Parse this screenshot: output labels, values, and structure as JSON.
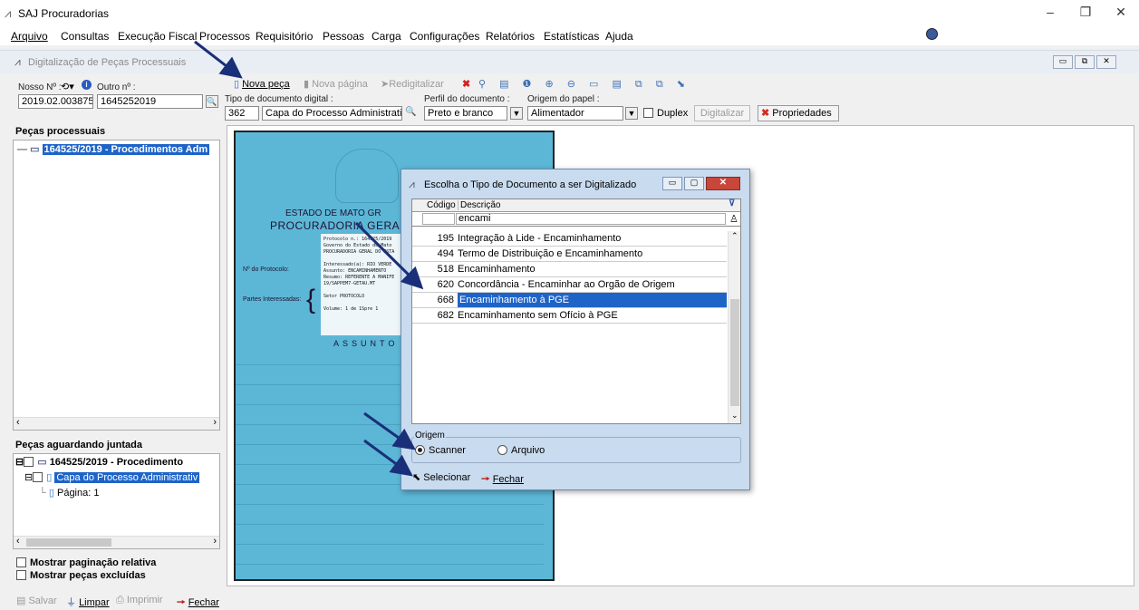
{
  "app": {
    "title": "SAJ Procuradorias",
    "menu": [
      "Arquivo",
      "Consultas",
      "Execução Fiscal",
      "Processos",
      "Requisitório",
      "Pessoas",
      "Carga",
      "Configurações",
      "Relatórios",
      "Estatísticas",
      "Ajuda"
    ]
  },
  "window": {
    "title": "Digitalização de Peças Processuais"
  },
  "form": {
    "nosso_label": "Nosso Nº :",
    "outro_label": "Outro nº :",
    "nosso_value": "2019.02.003875",
    "outro_value": "1645252019",
    "tipo_label": "Tipo de documento digital :",
    "tipo_code": "362",
    "tipo_desc": "Capa do Processo Administrativo",
    "perfil_label": "Perfil do documento :",
    "perfil_value": "Preto e branco",
    "origem_label": "Origem do papel :",
    "origem_value": "Alimentador",
    "duplex_label": "Duplex",
    "digitalizar_label": "Digitalizar",
    "propriedades_label": "Propriedades"
  },
  "toolbar": {
    "nova_peca": "Nova peça",
    "nova_pagina": "Nova página",
    "redigitalizar": "Redigitalizar"
  },
  "left": {
    "pecas_header": "Peças processuais",
    "pecas_item": "164525/2019 - Procedimentos Adm",
    "aguardando_header": "Peças aguardando juntada",
    "aguardando_item": "164525/2019 - Procedimento",
    "aguardando_child": "Capa do Processo Administrativ",
    "aguardando_page": "Página: 1",
    "mostrar_paginacao": "Mostrar paginação relativa",
    "mostrar_excluidas": "Mostrar peças excluídas"
  },
  "document": {
    "estado": "ESTADO DE MATO GR",
    "procuradoria": "PROCURADORIA GERAL",
    "protocolo_label": "Nº do Protocolo:",
    "partes_label": "Partes Interessadas:",
    "assunto": "ASSUNTO",
    "stamp_lines": [
      "Protocolo n.: 164525/2019",
      "Governo do Estado de Mato",
      "PROCURADORIA GERAL DO ESTA",
      "Interessado(a): RIO VERDE",
      "Assunto:  ENCAMINHAMENTO",
      "Resumo: REFERENTE A MANIFE",
      "19/SAPPEM7-GETAU.MT",
      "Setor          PROTOCOLO",
      "Volume: 1 de 1Spre 1"
    ]
  },
  "dialog": {
    "title": "Escolha o Tipo de Documento a ser Digitalizado",
    "col_codigo": "Código",
    "col_descricao": "Descrição",
    "filter_value": "encami",
    "rows": [
      {
        "code": "195",
        "desc": "Integração à Lide - Encaminhamento"
      },
      {
        "code": "494",
        "desc": "Termo de Distribuição e Encaminhamento"
      },
      {
        "code": "518",
        "desc": "Encaminhamento"
      },
      {
        "code": "620",
        "desc": "Concordância - Encaminhar ao Orgão de Origem"
      },
      {
        "code": "668",
        "desc": "Encaminhamento à PGE"
      },
      {
        "code": "682",
        "desc": "Encaminhamento sem Ofício à PGE"
      }
    ],
    "origem_label": "Origem",
    "scanner": "Scanner",
    "arquivo": "Arquivo",
    "selecionar": "Selecionar",
    "fechar": "Fechar"
  },
  "bottom": {
    "salvar": "Salvar",
    "limpar": "Limpar",
    "imprimir": "Imprimir",
    "fechar": "Fechar"
  },
  "colors": {
    "selection": "#1e64c8",
    "document_bg": "#5cb7d6",
    "dialog_bg": "#c9dbef",
    "arrow": "#1a2f7a"
  }
}
